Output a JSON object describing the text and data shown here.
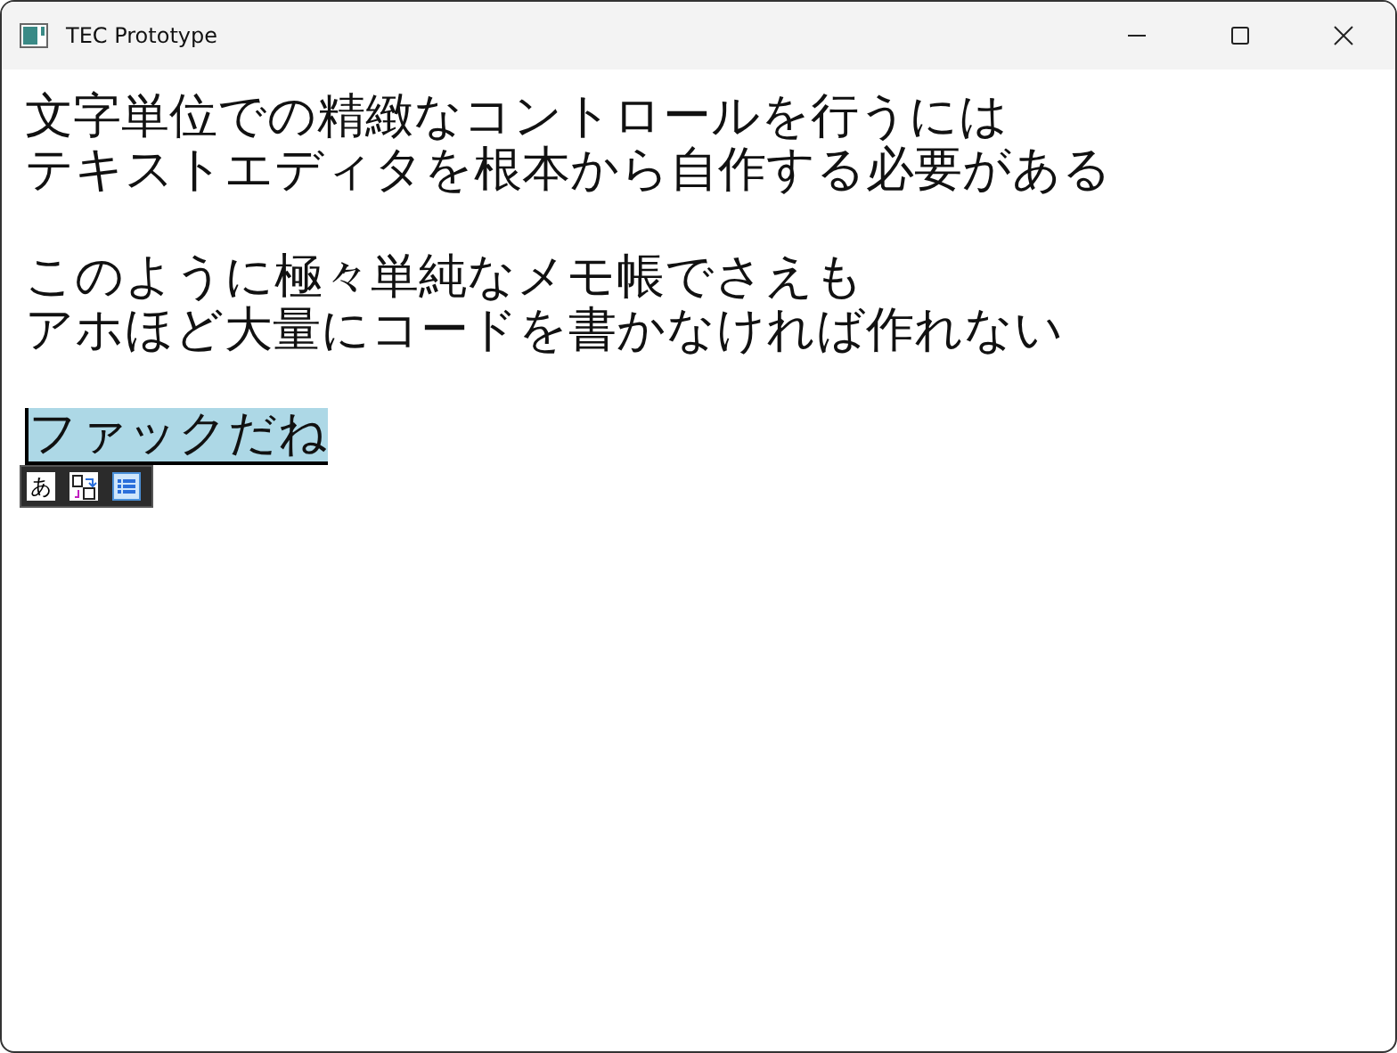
{
  "window": {
    "title": "TEC Prototype"
  },
  "paragraphs": [
    {
      "lines": [
        "文字単位での精緻なコントロールを行うには",
        "テキストエディタを根本から自作する必要がある"
      ]
    },
    {
      "lines": [
        "このように極々単純なメモ帳でさえも",
        "アホほど大量にコードを書かなければ作れない"
      ]
    }
  ],
  "composition": {
    "text": "ファックだね",
    "selected": true
  },
  "ime_toolbar": {
    "mode": "あ"
  }
}
